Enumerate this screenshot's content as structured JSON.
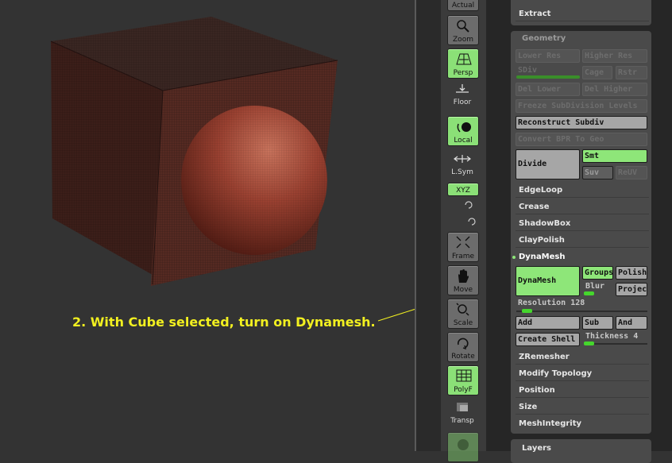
{
  "annotation": "2.  With Cube selected, turn on Dynamesh.",
  "colors": {
    "accent_on": "#8ee679",
    "annotation": "#f2f020",
    "slider": "#45d62d"
  },
  "toolbar": {
    "actual": "Actual",
    "zoom": "Zoom",
    "persp": "Persp",
    "floor": "Floor",
    "local": "Local",
    "lsym": "L.Sym",
    "xyz": "XYZ",
    "frame": "Frame",
    "move": "Move",
    "scale": "Scale",
    "rotate": "Rotate",
    "polyf": "PolyF",
    "transp": "Transp"
  },
  "panel_top": {
    "extract": "Extract"
  },
  "geometry": {
    "title": "Geometry",
    "lower_res": "Lower Res",
    "higher_res": "Higher Res",
    "sdiv": "SDiv",
    "cage": "Cage",
    "rstr": "Rstr",
    "del_lower": "Del Lower",
    "del_higher": "Del Higher",
    "freeze": "Freeze SubDivision Levels",
    "reconstruct": "Reconstruct Subdiv",
    "convert_bpr": "Convert BPR To Geo",
    "divide": "Divide",
    "smt": "Smt",
    "suv": "Suv",
    "reuv": "ReUV",
    "edgeloop": "EdgeLoop",
    "crease": "Crease",
    "shadowbox": "ShadowBox",
    "claypolish": "ClayPolish",
    "dynamesh_header": "DynaMesh",
    "dynamesh": "DynaMesh",
    "groups": "Groups",
    "polish": "Polish",
    "blur": "Blur",
    "project": "Projec",
    "resolution": "Resolution 128",
    "add": "Add",
    "sub": "Sub",
    "and": "And",
    "create_shell": "Create Shell",
    "thickness": "Thickness 4",
    "zremesher": "ZRemesher",
    "modify_topology": "Modify Topology",
    "position": "Position",
    "size": "Size",
    "meshintegrity": "MeshIntegrity"
  },
  "layers": {
    "title": "Layers"
  }
}
